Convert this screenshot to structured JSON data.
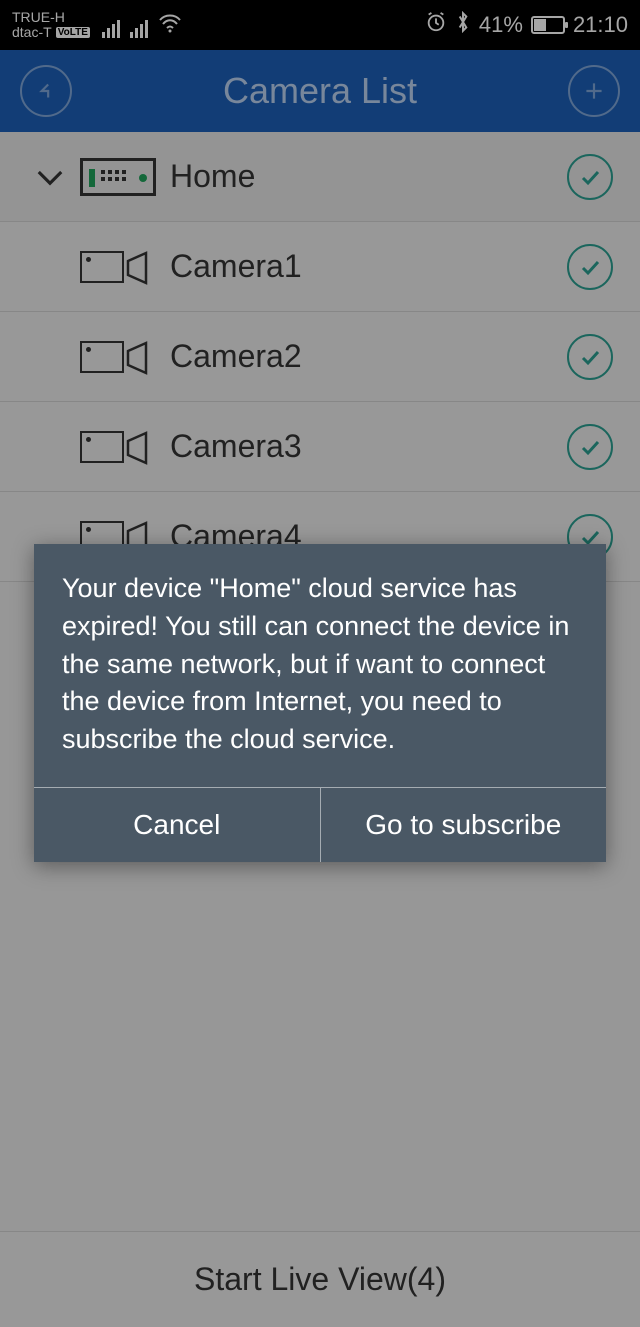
{
  "status": {
    "carrier1": "TRUE-H",
    "carrier2": "dtac-T",
    "volte": "VoLTE",
    "battery_pct": "41%",
    "time": "21:10"
  },
  "header": {
    "title": "Camera List"
  },
  "device": {
    "name": "Home"
  },
  "cameras": [
    {
      "name": "Camera1"
    },
    {
      "name": "Camera2"
    },
    {
      "name": "Camera3"
    },
    {
      "name": "Camera4"
    }
  ],
  "footer": {
    "label": "Start Live View(4)"
  },
  "dialog": {
    "message": "Your device \"Home\" cloud service has expired! You still can connect the device in the same network, but if want to connect the device from Internet, you need to subscribe the cloud service.",
    "cancel": "Cancel",
    "subscribe": "Go to subscribe"
  }
}
